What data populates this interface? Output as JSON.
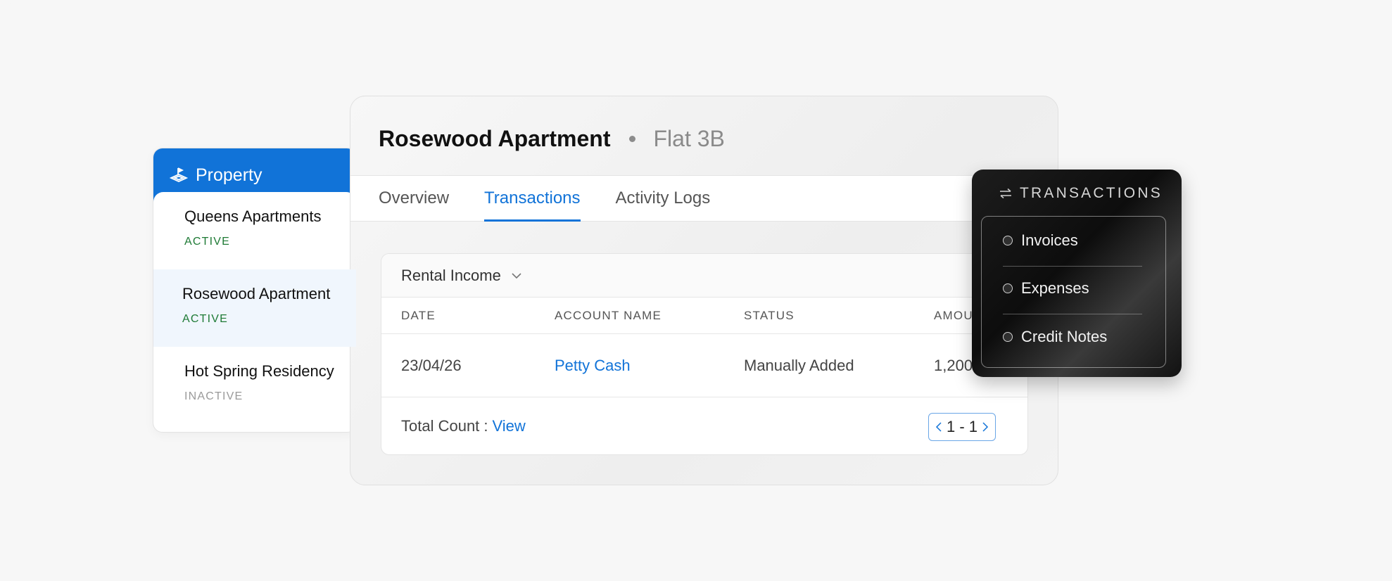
{
  "property_panel": {
    "title": "Property",
    "items": [
      {
        "name": "Queens Apartments",
        "status": "ACTIVE",
        "selected": false
      },
      {
        "name": "Rosewood Apartment",
        "status": "ACTIVE",
        "selected": true
      },
      {
        "name": "Hot Spring Residency",
        "status": "INACTIVE",
        "selected": false
      }
    ]
  },
  "main": {
    "title": "Rosewood Apartment",
    "subtitle": "Flat 3B",
    "tabs": [
      {
        "label": "Overview",
        "active": false
      },
      {
        "label": "Transactions",
        "active": true
      },
      {
        "label": "Activity Logs",
        "active": false
      }
    ],
    "filter": {
      "label": "Rental Income"
    },
    "table": {
      "headers": [
        "DATE",
        "ACCOUNT NAME",
        "STATUS",
        "AMOU"
      ],
      "rows": [
        {
          "date": "23/04/26",
          "account": "Petty Cash",
          "status": "Manually Added",
          "amount": "1,200"
        }
      ]
    },
    "footer": {
      "total_label": "Total Count :",
      "view_label": "View",
      "pagination": "1 - 1"
    }
  },
  "transactions_menu": {
    "title": "TRANSACTIONS",
    "items": [
      "Invoices",
      "Expenses",
      "Credit Notes"
    ]
  },
  "colors": {
    "accent": "#1173d8",
    "active_status": "#1e7a35",
    "inactive_status": "#9a9a9a",
    "background": "#f7f7f7"
  },
  "icons": {
    "property": "property-icon",
    "filter_dropdown": "chevron-down-icon",
    "transactions": "transfer-arrows-icon",
    "pager_prev": "chevron-left-icon",
    "pager_next": "chevron-right-icon"
  }
}
